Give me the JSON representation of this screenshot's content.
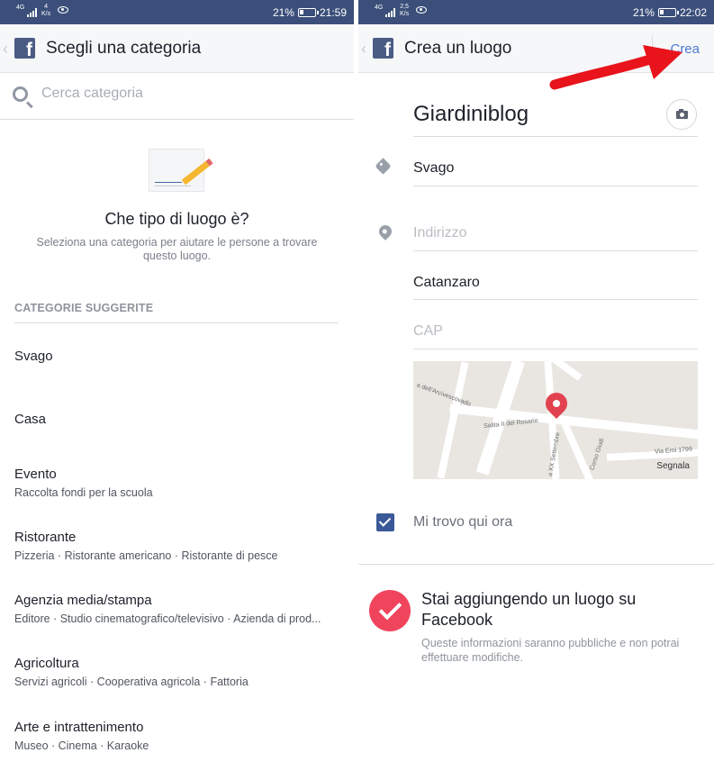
{
  "left": {
    "status": {
      "network": "4G",
      "speed_value": "4",
      "speed_unit": "K/s",
      "battery": "21%",
      "time": "21:59"
    },
    "header": {
      "back": "‹",
      "title": "Scegli una categoria"
    },
    "search": {
      "placeholder": "Cerca categoria"
    },
    "hero": {
      "title": "Che tipo di luogo è?",
      "subtitle": "Seleziona una categoria per aiutare le persone a trovare questo luogo."
    },
    "section_title": "CATEGORIE SUGGERITE",
    "categories": [
      {
        "name": "Svago",
        "sub": ""
      },
      {
        "name": "Casa",
        "sub": ""
      },
      {
        "name": "Evento",
        "sub": "Raccolta fondi per la scuola"
      },
      {
        "name": "Ristorante",
        "sub": "Pizzeria · Ristorante americano · Ristorante di pesce"
      },
      {
        "name": "Agenzia media/stampa",
        "sub": "Editore · Studio cinematografico/televisivo · Azienda di prod..."
      },
      {
        "name": "Agricoltura",
        "sub": "Servizi agricoli · Cooperativa agricola · Fattoria"
      },
      {
        "name": "Arte e intrattenimento",
        "sub": "Museo · Cinema · Karaoke"
      }
    ]
  },
  "right": {
    "status": {
      "network": "4G",
      "speed_value": "2,5",
      "speed_unit": "K/s",
      "battery": "21%",
      "time": "22:02"
    },
    "header": {
      "back": "‹",
      "title": "Crea un luogo",
      "action": "Crea"
    },
    "form": {
      "name": "Giardiniblog",
      "category": "Svago",
      "address_placeholder": "Indirizzo",
      "city": "Catanzaro",
      "cap_placeholder": "CAP"
    },
    "map": {
      "labels": [
        "a dell'Arcivescovado",
        "Salita II del Rosario",
        "a XX Settembre",
        "Corso Giudi",
        "Via Eroi 1799"
      ],
      "attribution": "Segnala"
    },
    "checkin": {
      "label": "Mi trovo qui ora",
      "checked": true
    },
    "notice": {
      "title": "Stai aggiungendo un luogo su Facebook",
      "subtitle": "Queste informazioni saranno pubbliche e non potrai effettuare modifiche."
    }
  },
  "colors": {
    "status_bar": "#3b4f7a",
    "facebook_blue": "#3b5998",
    "action_blue": "#4c7bd0",
    "pin_red": "#e2424f",
    "badge_red": "#f0445d",
    "arrow_red": "#e8131b"
  }
}
